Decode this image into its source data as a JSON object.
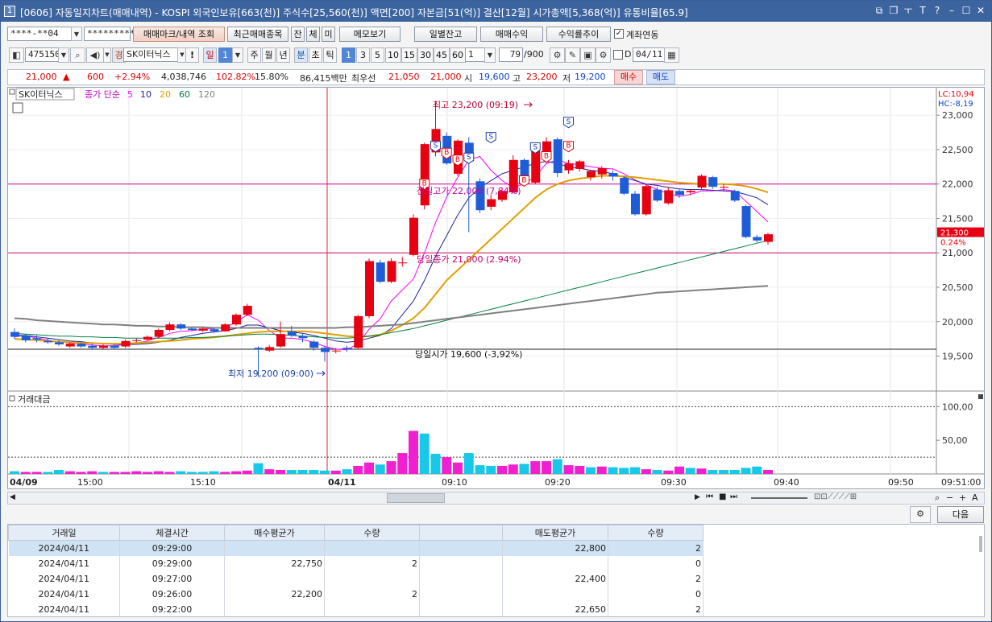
{
  "window": {
    "icon": "1",
    "title": "[0606] 자동일지차트(매매내역) - KOSPI 외국인보유[663(천)] 주식수[25,560(천)] 액면[200] 자본금[51(억)] 결산[12월] 시가총액[5,368(억)] 유통비율[65.9]"
  },
  "toolbar1": {
    "account": "****-**04",
    "password": "*********",
    "trade_mark_btn": "매매마크/내역 조회",
    "recent_btn": "최근매매종목",
    "tab_jan": "잔",
    "tab_che": "체",
    "tab_mi": "미",
    "memo_btn": "메모보기",
    "daily_btn": "일별잔고",
    "profit_btn": "매매수익",
    "rate_btn": "수익률추이",
    "link_label": "계좌연동"
  },
  "toolbar2": {
    "code": "475150",
    "market_badge": "경",
    "stock_name": "SK이터닉스",
    "excl": "!",
    "period_day": "일",
    "period_num": "1",
    "week": "주",
    "month": "월",
    "year": "년",
    "minute": "분",
    "sec": "초",
    "tick": "틱",
    "intervals": [
      "1",
      "3",
      "5",
      "10",
      "15",
      "30",
      "45",
      "60"
    ],
    "count_sel": "1",
    "count": "79",
    "count_total": "/900",
    "date": "04/11",
    "d_label": "D"
  },
  "quote": {
    "price": "21,000",
    "arrow": "▲",
    "change": "600",
    "change_pct": "+2.94%",
    "volume": "4,038,746",
    "vol_ratio": "102.82%",
    "turnover": "15.80%",
    "amount": "86,415백만",
    "best_ask_label": "최우선",
    "ask": "21,050",
    "bid": "21,000",
    "open_label": "시",
    "open": "19,600",
    "high_label": "고",
    "high": "23,200",
    "low_label": "저",
    "low": "19,200",
    "buy_btn": "매수",
    "sell_btn": "매도"
  },
  "chart_data": [
    {
      "type": "candlestick",
      "legend": {
        "name": "SK이터닉스",
        "line_label": "종가 단순",
        "ma": [
          "5",
          "10",
          "20",
          "60",
          "120"
        ],
        "ma_colors": [
          "#ff00ff",
          "#2020a0",
          "#e0a000",
          "#008040",
          "#808080"
        ]
      },
      "y_ticks": [
        "23,000",
        "22,500",
        "22,000",
        "21,500",
        "21,000",
        "20,500",
        "20,000",
        "19,500"
      ],
      "ylim": [
        19050,
        23400
      ],
      "x_ticks": [
        "04/09",
        "15:00",
        "15:10",
        "04/11",
        "09:10",
        "09:20",
        "09:30",
        "09:40",
        "09:50",
        "09:51:00"
      ],
      "annotations": {
        "high": "최고 23,200 (09:19)",
        "low": "최저 19,200 (09:00)",
        "prev_high": "전일고가 22,000 (7,84%)",
        "prev_close": "당일종가 21,000 (2.94%)",
        "today_open": "당일시가 19,600 (-3,92%)"
      },
      "right_labels": {
        "lc": "LC:10,94",
        "hc": "HC:-8,19",
        "last": "21,300",
        "last_pct": "0.24%"
      },
      "buy_marker": "B",
      "sell_marker": "S",
      "candles": [
        [
          19850,
          19780,
          19900,
          19750
        ],
        [
          19800,
          19730,
          19820,
          19700
        ],
        [
          19760,
          19740,
          19800,
          19700
        ],
        [
          19720,
          19700,
          19760,
          19680
        ],
        [
          19700,
          19670,
          19730,
          19650
        ],
        [
          19640,
          19680,
          19700,
          19620
        ],
        [
          19680,
          19640,
          19700,
          19620
        ],
        [
          19650,
          19620,
          19680,
          19600
        ],
        [
          19620,
          19650,
          19670,
          19600
        ],
        [
          19650,
          19620,
          19670,
          19600
        ],
        [
          19640,
          19720,
          19740,
          19620
        ],
        [
          19720,
          19730,
          19760,
          19700
        ],
        [
          19740,
          19780,
          19800,
          19720
        ],
        [
          19780,
          19880,
          19900,
          19760
        ],
        [
          19880,
          19960,
          19990,
          19860
        ],
        [
          19960,
          19900,
          19980,
          19880
        ],
        [
          19900,
          19880,
          19920,
          19860
        ],
        [
          19870,
          19900,
          19920,
          19850
        ],
        [
          19890,
          19860,
          19910,
          19840
        ],
        [
          19860,
          19960,
          19980,
          19850
        ],
        [
          19960,
          20100,
          20120,
          19940
        ],
        [
          20100,
          20230,
          20260,
          20080
        ],
        [
          19620,
          19600,
          19640,
          19200
        ],
        [
          19580,
          19630,
          19660,
          19560
        ],
        [
          19640,
          19820,
          20000,
          19620
        ],
        [
          19860,
          19800,
          19940,
          19780
        ],
        [
          19790,
          19760,
          19820,
          19700
        ],
        [
          19710,
          19620,
          19730,
          19580
        ],
        [
          19620,
          19560,
          19650,
          19420
        ],
        [
          19570,
          19580,
          19620,
          19540
        ],
        [
          19620,
          19600,
          19650,
          19560
        ],
        [
          19620,
          20080,
          20100,
          19600
        ],
        [
          20080,
          20880,
          20920,
          20050
        ],
        [
          20860,
          20580,
          20900,
          20560
        ],
        [
          20580,
          20880,
          20920,
          20560
        ],
        [
          20860,
          20860,
          20940,
          20800
        ],
        [
          20970,
          21510,
          21560,
          20950
        ],
        [
          21690,
          22580,
          22600,
          21630
        ],
        [
          22460,
          22800,
          23200,
          22400
        ],
        [
          22700,
          22300,
          22750,
          22280
        ],
        [
          22150,
          22630,
          22650,
          22120
        ],
        [
          22600,
          22330,
          22680,
          21300
        ],
        [
          22040,
          21620,
          22080,
          21580
        ],
        [
          21670,
          21780,
          21850,
          21620
        ],
        [
          21770,
          21900,
          21950,
          21740
        ],
        [
          21880,
          22350,
          22420,
          21860
        ],
        [
          22350,
          22090,
          22370,
          22050
        ],
        [
          22020,
          22520,
          22560,
          22000
        ],
        [
          22420,
          22620,
          22680,
          22300
        ],
        [
          22650,
          22160,
          22680,
          22100
        ],
        [
          22200,
          22300,
          22350,
          22150
        ],
        [
          22220,
          22330,
          22350,
          22180
        ],
        [
          22100,
          22190,
          22200,
          22050
        ],
        [
          22140,
          22230,
          22260,
          22080
        ],
        [
          22160,
          22110,
          22200,
          22050
        ],
        [
          22090,
          21860,
          22120,
          21840
        ],
        [
          21860,
          21560,
          21900,
          21540
        ],
        [
          21560,
          21970,
          22000,
          21540
        ],
        [
          21920,
          21760,
          21960,
          21740
        ],
        [
          21720,
          21910,
          21960,
          21700
        ],
        [
          21900,
          21840,
          21930,
          21800
        ],
        [
          21880,
          21900,
          21920,
          21840
        ],
        [
          21950,
          22120,
          22140,
          21930
        ],
        [
          22100,
          21960,
          22120,
          21930
        ],
        [
          21950,
          21960,
          22000,
          21900
        ],
        [
          21900,
          21760,
          21920,
          21740
        ],
        [
          21680,
          21230,
          21700,
          21210
        ],
        [
          21230,
          21180,
          21260,
          21150
        ],
        [
          21160,
          21270,
          21290,
          21120
        ]
      ],
      "ma_values": {
        "5": [
          19780,
          19800,
          19760,
          19730,
          19710,
          19690,
          19680,
          19660,
          19650,
          19650,
          19670,
          19690,
          19720,
          19770,
          19830,
          19860,
          19870,
          19890,
          19900,
          19920,
          19990,
          20100,
          20020,
          19870,
          19760,
          19760,
          19740,
          19700,
          19640,
          19600,
          19590,
          19680,
          19890,
          20040,
          20300,
          20460,
          20620,
          21000,
          21440,
          21810,
          22100,
          22350,
          22400,
          22200,
          22050,
          21950,
          22000,
          22110,
          22300,
          22350,
          22300,
          22280,
          22250,
          22230,
          22220,
          22150,
          22060,
          21990,
          21920,
          21860,
          21820,
          21850,
          21900,
          21900,
          21920,
          21900,
          21750,
          21600,
          21450
        ],
        "10": [
          19800,
          19800,
          19780,
          19760,
          19740,
          19720,
          19710,
          19690,
          19680,
          19670,
          19670,
          19670,
          19680,
          19700,
          19730,
          19770,
          19800,
          19830,
          19850,
          19870,
          19900,
          19950,
          19950,
          19910,
          19870,
          19850,
          19830,
          19800,
          19760,
          19720,
          19700,
          19720,
          19760,
          19800,
          19900,
          20100,
          20300,
          20600,
          20950,
          21250,
          21550,
          21800,
          21950,
          22050,
          22150,
          22200,
          22250,
          22300,
          22330,
          22300,
          22250,
          22230,
          22200,
          22180,
          22150,
          22100,
          22050,
          22000,
          21980,
          21950,
          21930,
          21920,
          21920,
          21910,
          21900,
          21890,
          21850,
          21800,
          21700
        ],
        "20": [
          19750,
          19740,
          19730,
          19720,
          19710,
          19700,
          19690,
          19690,
          19680,
          19680,
          19680,
          19690,
          19700,
          19710,
          19720,
          19730,
          19750,
          19760,
          19770,
          19790,
          19810,
          19830,
          19850,
          19860,
          19860,
          19860,
          19860,
          19850,
          19830,
          19810,
          19790,
          19780,
          19790,
          19810,
          19870,
          19950,
          20050,
          20200,
          20400,
          20600,
          20750,
          20900,
          21050,
          21200,
          21350,
          21500,
          21650,
          21800,
          21920,
          22000,
          22050,
          22080,
          22100,
          22120,
          22120,
          22110,
          22100,
          22080,
          22060,
          22040,
          22020,
          22010,
          22000,
          22000,
          22000,
          21990,
          21970,
          21930,
          21880
        ],
        "60": [
          19830,
          19820,
          19810,
          19800,
          19790,
          19790,
          19780,
          19780,
          19770,
          19770,
          19760,
          19760,
          19760,
          19760,
          19760,
          19760,
          19770,
          19770,
          19780,
          19790,
          19800,
          19810,
          19820,
          19820,
          19810,
          19800,
          19790,
          19780,
          19770,
          19760,
          19760,
          19770,
          19790,
          19810,
          19840,
          19870,
          19900,
          19940,
          19980,
          20020,
          20060,
          20100,
          20140,
          20180,
          20220,
          20260,
          20300,
          20340,
          20380,
          20420,
          20460,
          20500,
          20540,
          20580,
          20620,
          20660,
          20700,
          20740,
          20780,
          20820,
          20860,
          20900,
          20940,
          20980,
          21020,
          21060,
          21100,
          21140,
          21180
        ],
        "120": [
          20050,
          20040,
          20020,
          20010,
          20000,
          19990,
          19980,
          19970,
          19960,
          19960,
          19950,
          19940,
          19940,
          19930,
          19930,
          19920,
          19920,
          19920,
          19910,
          19910,
          19910,
          19910,
          19910,
          19910,
          19910,
          19910,
          19910,
          19910,
          19910,
          19910,
          19920,
          19920,
          19930,
          19940,
          19950,
          19960,
          19980,
          20000,
          20020,
          20040,
          20060,
          20080,
          20100,
          20120,
          20140,
          20160,
          20180,
          20200,
          20220,
          20240,
          20260,
          20280,
          20300,
          20320,
          20340,
          20360,
          20380,
          20400,
          20420,
          20430,
          20440,
          20450,
          20460,
          20470,
          20480,
          20490,
          20500,
          20510,
          20520
        ]
      }
    },
    {
      "type": "bar",
      "title": "거래대금",
      "y_ticks": [
        "100,00",
        "50,00"
      ],
      "ylim": [
        0,
        110
      ],
      "values": [
        4,
        3,
        3,
        3,
        6,
        4,
        3,
        4,
        3,
        3,
        3,
        4,
        3,
        4,
        3,
        4,
        3,
        3,
        4,
        3,
        4,
        5,
        16,
        7,
        6,
        6,
        6,
        6,
        5,
        5,
        7,
        12,
        17,
        14,
        19,
        31,
        64,
        60,
        30,
        25,
        17,
        31,
        13,
        12,
        12,
        14,
        15,
        19,
        19,
        22,
        13,
        12,
        10,
        11,
        10,
        9,
        10,
        7,
        6,
        5,
        11,
        9,
        8,
        6,
        6,
        6,
        9,
        11,
        6
      ],
      "colors": [
        "c",
        "m",
        "m",
        "c",
        "c",
        "m",
        "m",
        "m",
        "c",
        "m",
        "m",
        "m",
        "m",
        "m",
        "m",
        "c",
        "c",
        "c",
        "c",
        "m",
        "m",
        "m",
        "c",
        "m",
        "m",
        "c",
        "c",
        "c",
        "c",
        "m",
        "c",
        "m",
        "m",
        "c",
        "m",
        "m",
        "m",
        "c",
        "c",
        "m",
        "m",
        "c",
        "c",
        "c",
        "m",
        "m",
        "c",
        "m",
        "m",
        "c",
        "m",
        "m",
        "c",
        "m",
        "c",
        "c",
        "c",
        "m",
        "c",
        "m",
        "m",
        "c",
        "m",
        "c",
        "c",
        "c",
        "c",
        "c",
        "m"
      ]
    }
  ],
  "nav": {
    "prev_label": "◀",
    "next_label": "▶"
  },
  "bottom": {
    "settings_icon": "gear-icon",
    "next_btn": "다음",
    "headers": [
      "거래일",
      "체결시간",
      "매수평균가",
      "수량",
      "",
      "매도평균가",
      "수량"
    ],
    "rows": [
      [
        "2024/04/11",
        "09:29:00",
        "",
        "",
        "",
        "22,800",
        "2"
      ],
      [
        "2024/04/11",
        "09:29:00",
        "22,750",
        "2",
        "",
        "",
        "0"
      ],
      [
        "2024/04/11",
        "09:27:00",
        "",
        "",
        "",
        "22,400",
        "2"
      ],
      [
        "2024/04/11",
        "09:26:00",
        "22,200",
        "2",
        "",
        "",
        "0"
      ],
      [
        "2024/04/11",
        "09:22:00",
        "",
        "",
        "",
        "22,650",
        "2"
      ]
    ]
  }
}
